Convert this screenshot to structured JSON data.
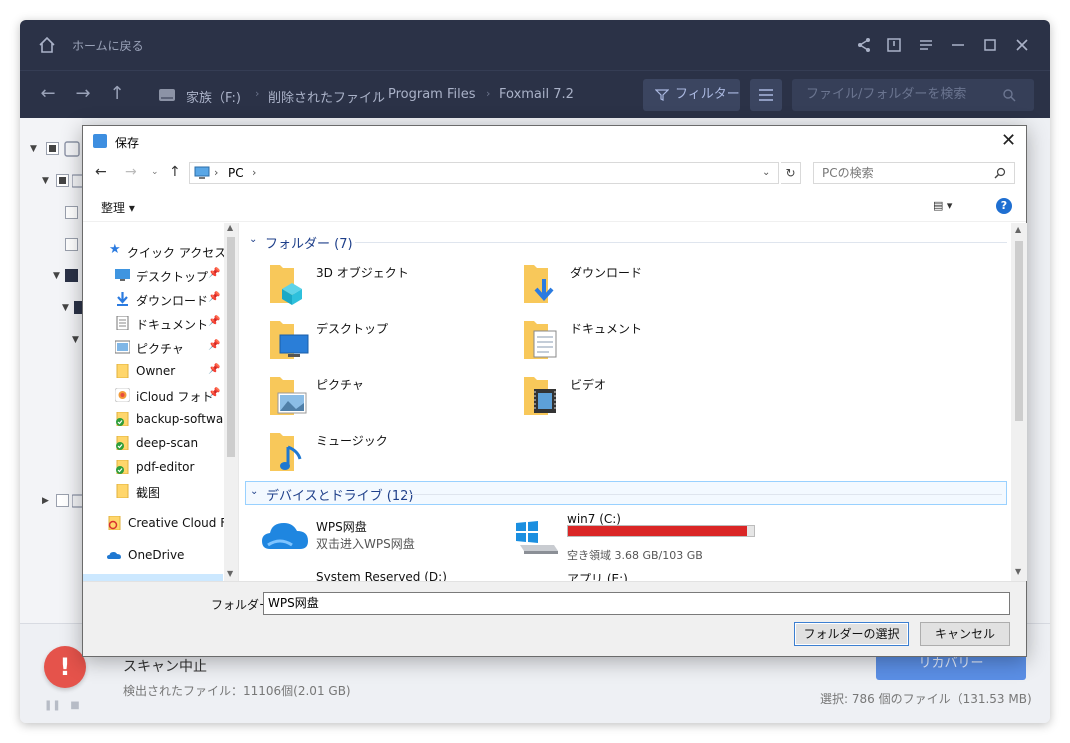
{
  "titlebar": {
    "home_label": "ホームに戻る"
  },
  "breadcrumb": {
    "drive": "家族（F:)",
    "items": [
      "削除されたファイル",
      "Program Files",
      "Foxmail 7.2"
    ]
  },
  "toolbar": {
    "filter_label": "フィルター",
    "search_placeholder": "ファイル/フォルダーを検索"
  },
  "status": {
    "title": "スキャン中止",
    "found": "検出されたファイル：11106個(2.01 GB)",
    "recover_label": "リカバリー",
    "selected": "選択: 786 個のファイル（131.53 MB)"
  },
  "dialog": {
    "title": "保存",
    "address": {
      "location": "PC",
      "search_placeholder": "PCの検索"
    },
    "organize_label": "整理",
    "nav": [
      {
        "label": "クイック アクセス",
        "icon": "star-icon",
        "pinned": false
      },
      {
        "label": "デスクトップ",
        "icon": "desktop-icon",
        "pinned": true
      },
      {
        "label": "ダウンロード",
        "icon": "download-icon",
        "pinned": true
      },
      {
        "label": "ドキュメント",
        "icon": "document-icon",
        "pinned": true
      },
      {
        "label": "ピクチャ",
        "icon": "picture-icon",
        "pinned": true
      },
      {
        "label": "Owner",
        "icon": "folder-icon",
        "pinned": true
      },
      {
        "label": "iCloud フォト",
        "icon": "icloud-photos-icon",
        "pinned": true
      },
      {
        "label": "backup-software",
        "icon": "synced-folder-icon",
        "pinned": false
      },
      {
        "label": "deep-scan",
        "icon": "synced-folder-icon",
        "pinned": false
      },
      {
        "label": "pdf-editor",
        "icon": "synced-folder-icon",
        "pinned": false
      },
      {
        "label": "截图",
        "icon": "folder-icon",
        "pinned": false
      },
      {
        "label": "Creative Cloud File",
        "icon": "creative-cloud-icon",
        "pinned": false
      },
      {
        "label": "OneDrive",
        "icon": "onedrive-icon",
        "pinned": false
      }
    ],
    "folders_header": "フォルダー (7)",
    "folders": [
      {
        "name": "3D オブジェクト",
        "icon": "3d-objects-folder-icon"
      },
      {
        "name": "ダウンロード",
        "icon": "downloads-folder-icon"
      },
      {
        "name": "デスクトップ",
        "icon": "desktop-folder-icon"
      },
      {
        "name": "ドキュメント",
        "icon": "documents-folder-icon"
      },
      {
        "name": "ピクチャ",
        "icon": "pictures-folder-icon"
      },
      {
        "name": "ビデオ",
        "icon": "videos-folder-icon"
      },
      {
        "name": "ミュージック",
        "icon": "music-folder-icon"
      }
    ],
    "drives_header": "デバイスとドライブ (12)",
    "drives": [
      {
        "name": "WPS网盘",
        "sub": "双击进入WPS网盘",
        "icon": "wps-cloud-icon"
      },
      {
        "name": "win7 (C:)",
        "sub": "空き領域 3.68 GB/103 GB",
        "used_fraction": 0.964,
        "icon": "windows-drive-icon"
      },
      {
        "name": "System Reserved (D:)",
        "icon": "drive-icon"
      },
      {
        "name": "アプリ (E:)",
        "icon": "drive-icon"
      }
    ],
    "folder_label": "フォルダー:",
    "folder_value": "WPS网盘",
    "select_button": "フォルダーの選択",
    "cancel_button": "キャンセル"
  },
  "colors": {
    "app_dark": "#2b3247",
    "accent_blue": "#5b8fe6",
    "drive_bar_red": "#da2626",
    "group_header_blue": "#1e3f8a"
  }
}
